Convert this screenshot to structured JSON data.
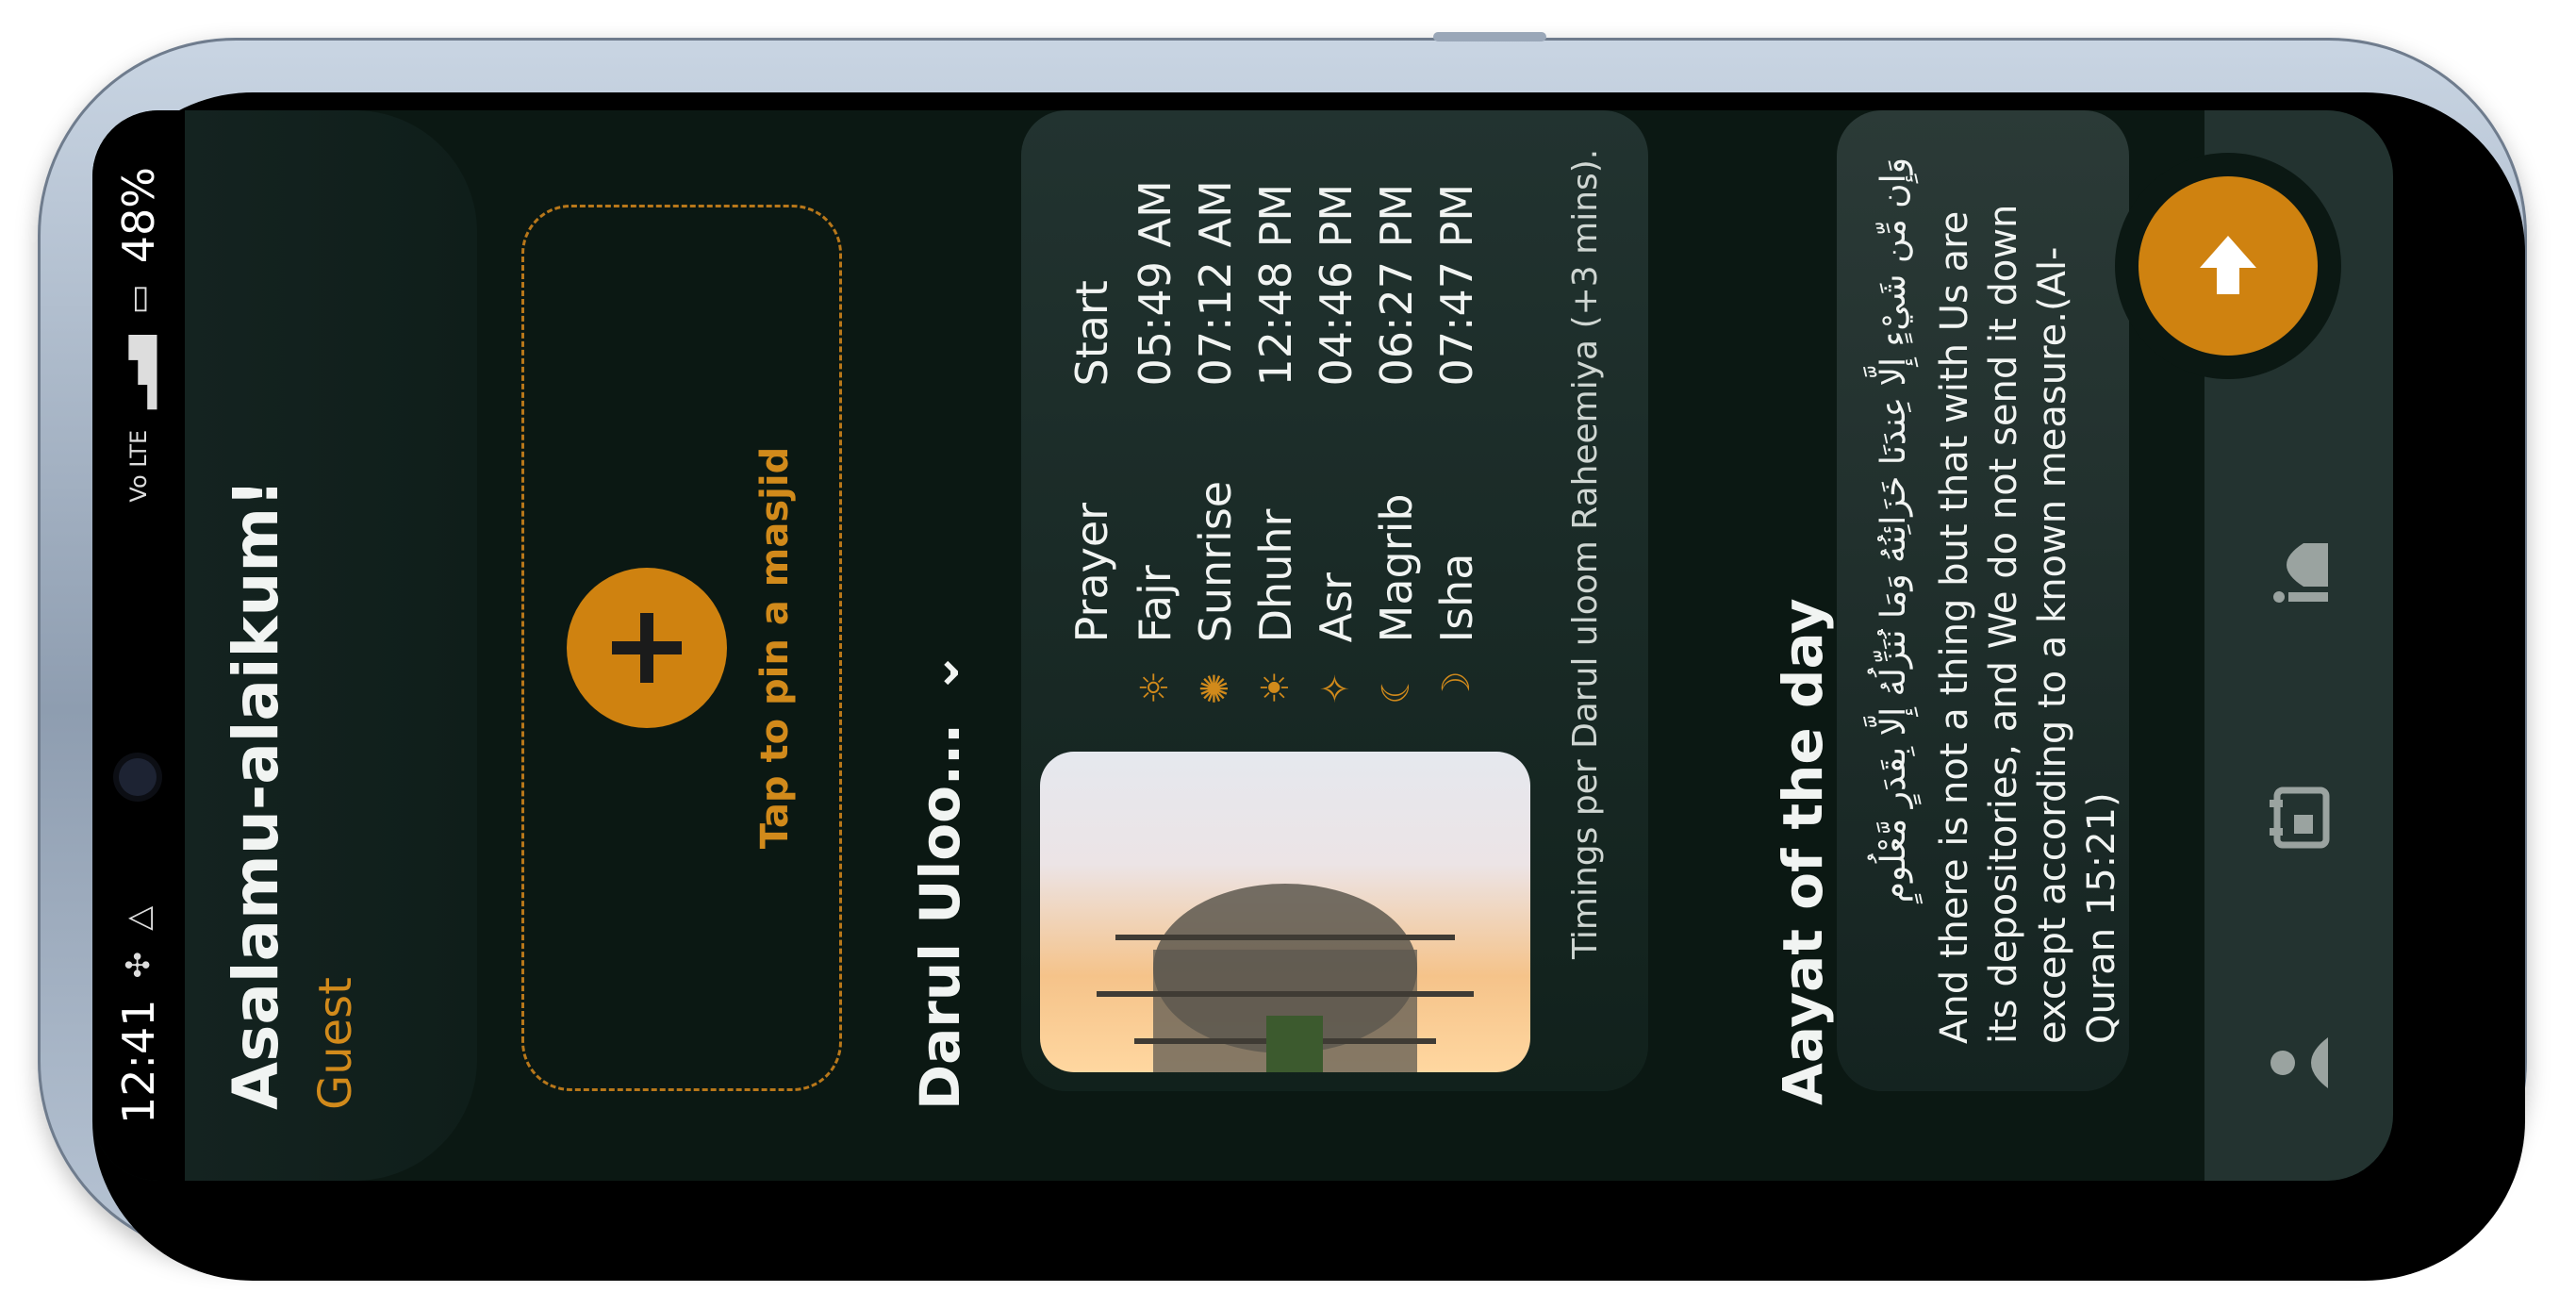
{
  "status_bar": {
    "time": "12:41",
    "battery": "48%",
    "network": "Vo LTE"
  },
  "header": {
    "greeting": "Asalamu-alaikum!",
    "user": "Guest"
  },
  "pin_card": {
    "label": "Tap to pin a masjid",
    "icon": "plus-icon"
  },
  "masjid": {
    "title": "Darul Uloo...",
    "chevron_icon": "chevron-down-icon"
  },
  "timings": {
    "headers": {
      "prayer": "Prayer",
      "start": "Start"
    },
    "rows": [
      {
        "icon": "sunrise-icon",
        "name": "Fajr",
        "time": "05:49  AM"
      },
      {
        "icon": "gear-sun-icon",
        "name": "Sunrise",
        "time": "07:12  AM"
      },
      {
        "icon": "sun-icon",
        "name": "Dhuhr",
        "time": "12:48  PM"
      },
      {
        "icon": "sun-small-icon",
        "name": "Asr",
        "time": "04:46  PM"
      },
      {
        "icon": "sunset-icon",
        "name": "Magrib",
        "time": "06:27  PM"
      },
      {
        "icon": "moon-icon",
        "name": "Isha",
        "time": "07:47  PM"
      }
    ],
    "note": "Timings per Darul uloom Raheemiya (+3 mins)."
  },
  "aayat": {
    "title": "Aayat of the day",
    "arabic": "وَإِن مِّن شَيْءٍ إِلَّا عِندَنَا خَزَائِنُهُ وَمَا نُنَزِّلُهُ إِلَّا بِقَدَرٍ مَّعْلُومٍ",
    "translation": "And there is not a thing but that with Us are its depositories, and We do not send it down except according to a known measure.(Al-Quran 15:21)"
  },
  "bottom_nav": {
    "items": [
      {
        "icon": "person-icon"
      },
      {
        "icon": "calendar-icon"
      },
      {
        "icon": "mosque-icon"
      }
    ],
    "fab_icon": "arrow-right-icon"
  },
  "colors": {
    "accent": "#cf8210",
    "background": "#0b1813",
    "card": "#223330"
  }
}
